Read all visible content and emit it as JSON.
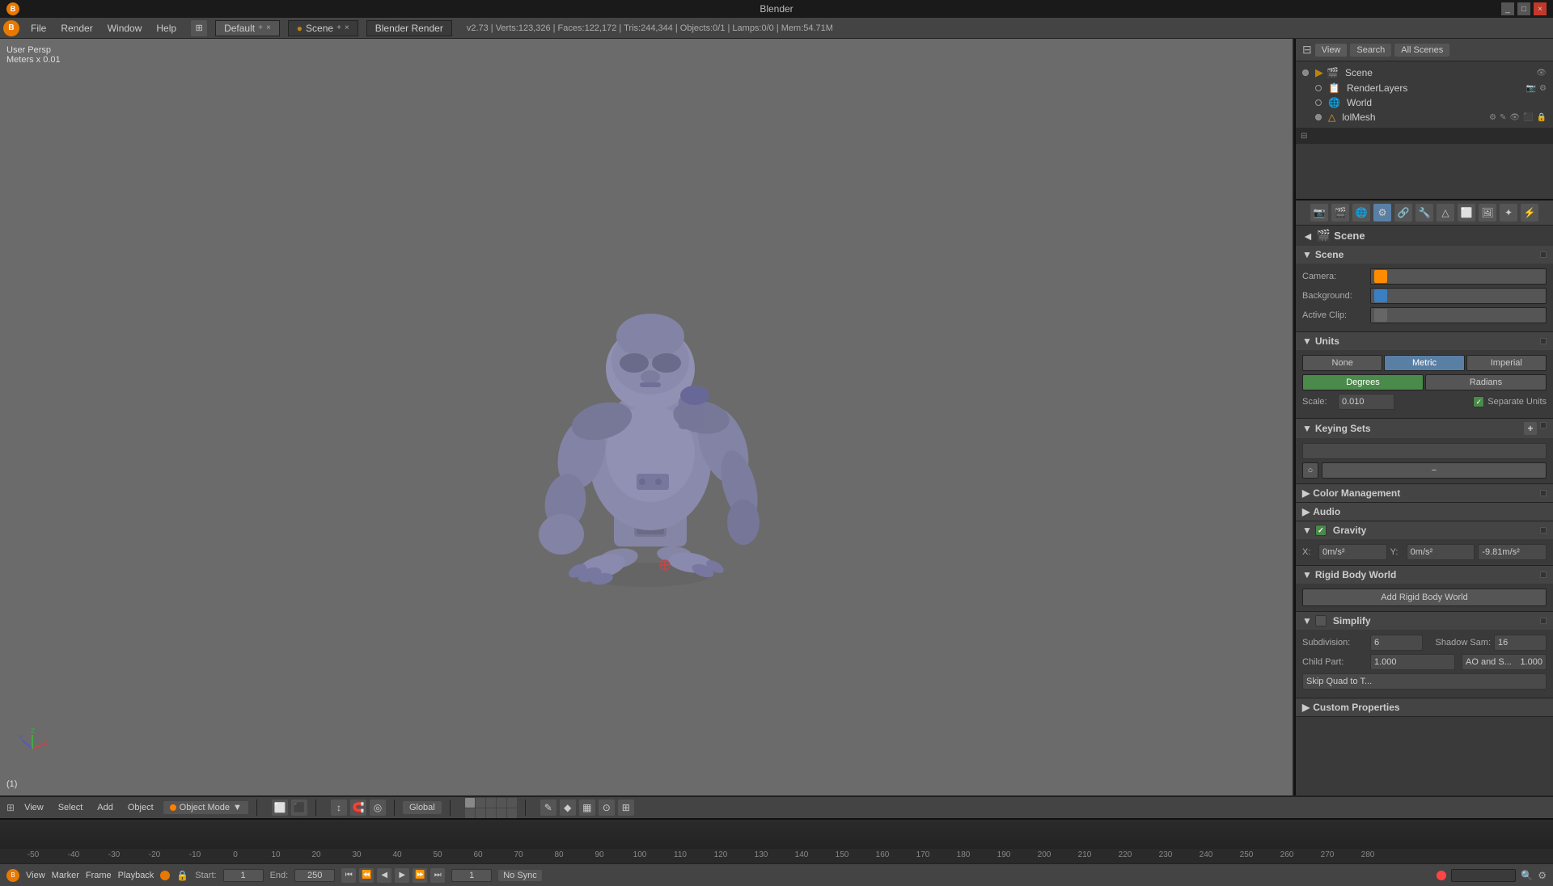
{
  "app": {
    "title": "Blender",
    "logo": "B",
    "version_info": "v2.73 | Verts:123,326 | Faces:122,172 | Tris:244,344 | Objects:0/1 | Lamps:0/0 | Mem:54.71M"
  },
  "menu": {
    "items": [
      "File",
      "Render",
      "Window",
      "Help"
    ],
    "workspace_tab": "Default",
    "scene_tab": "Scene",
    "engine": "Blender Render",
    "add_tab_label": "+",
    "close_tab_label": "×"
  },
  "viewport": {
    "perspective": "User Persp",
    "scale_info": "Meters x 0.01",
    "frame_label": "(1)"
  },
  "outliner": {
    "tabs": [
      "View",
      "Search",
      "All Scenes"
    ],
    "tree_items": [
      {
        "label": "Scene",
        "icon": "🎬",
        "indent": 0,
        "type": "scene"
      },
      {
        "label": "RenderLayers",
        "icon": "📋",
        "indent": 1,
        "type": "renderlayers"
      },
      {
        "label": "World",
        "icon": "🌐",
        "indent": 1,
        "type": "world"
      },
      {
        "label": "lolMesh",
        "icon": "△",
        "indent": 1,
        "type": "mesh"
      }
    ]
  },
  "properties": {
    "scene_title": "Scene",
    "scene_section": {
      "header": "Scene",
      "camera_label": "Camera:",
      "background_label": "Background:",
      "active_clip_label": "Active Clip:"
    },
    "units_section": {
      "header": "Units",
      "none_label": "None",
      "metric_label": "Metric",
      "imperial_label": "Imperial",
      "degrees_label": "Degrees",
      "radians_label": "Radians",
      "scale_label": "Scale:",
      "scale_value": "0.010",
      "separate_units_label": "Separate Units"
    },
    "keying_section": {
      "header": "Keying Sets",
      "add_label": "+",
      "minus_label": "−"
    },
    "color_management_section": {
      "header": "Color Management",
      "collapsed": true
    },
    "audio_section": {
      "header": "Audio",
      "collapsed": true
    },
    "gravity_section": {
      "header": "Gravity",
      "x_label": "X:",
      "x_value": "0m/s²",
      "y_label": "Y:",
      "y_value": "0m/s²",
      "z_value": "-9.81m/s²"
    },
    "rigid_body_world_section": {
      "header": "Rigid Body World",
      "collapsed": false,
      "add_btn": "Add Rigid Body World"
    },
    "simplify_section": {
      "header": "Simplify",
      "subdivision_label": "Subdivision:",
      "subdivision_value": "6",
      "shadow_sam_label": "Shadow Sam:",
      "shadow_sam_value": "16",
      "child_part_label": "Child Part:",
      "child_part_value": "1.000",
      "ao_s_label": "AO and S...",
      "ao_s_value": "1.000",
      "skip_quad_label": "Skip Quad to T..."
    },
    "custom_properties_section": {
      "header": "Custom Properties",
      "collapsed": true
    }
  },
  "bottom_toolbar": {
    "view_label": "View",
    "select_label": "Select",
    "add_label": "Add",
    "object_label": "Object",
    "mode_label": "Object Mode",
    "global_label": "Global"
  },
  "timeline": {
    "frame_numbers": [
      "-50",
      "-40",
      "-30",
      "-20",
      "-10",
      "0",
      "10",
      "20",
      "30",
      "40",
      "50",
      "60",
      "70",
      "80",
      "90",
      "100",
      "110",
      "120",
      "130",
      "140",
      "150",
      "160",
      "170",
      "180",
      "190",
      "200",
      "210",
      "220",
      "230",
      "240",
      "250",
      "260",
      "270",
      "280"
    ]
  },
  "statusbar": {
    "view_label": "View",
    "marker_label": "Marker",
    "frame_label": "Frame",
    "playback_label": "Playback",
    "start_label": "Start:",
    "start_value": "1",
    "end_label": "End:",
    "end_value": "250",
    "current_frame": "1",
    "no_sync_label": "No Sync"
  }
}
